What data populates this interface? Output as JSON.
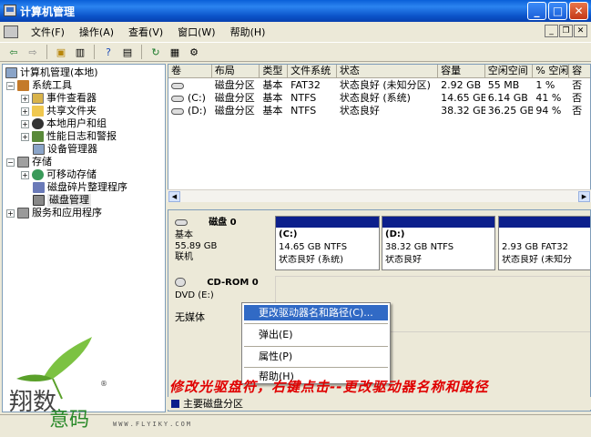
{
  "window": {
    "title": "计算机管理"
  },
  "menu": [
    "文件(F)",
    "操作(A)",
    "查看(V)",
    "窗口(W)",
    "帮助(H)"
  ],
  "tree": {
    "root": "计算机管理(本地)",
    "system_tools": "系统工具",
    "event_viewer": "事件查看器",
    "shared_folders": "共享文件夹",
    "local_users": "本地用户和组",
    "perf_logs": "性能日志和警报",
    "device_manager": "设备管理器",
    "storage": "存储",
    "removable": "可移动存储",
    "defrag": "磁盘碎片整理程序",
    "disk_mgmt": "磁盘管理",
    "services": "服务和应用程序"
  },
  "volume_table": {
    "headers": [
      "卷",
      "布局",
      "类型",
      "文件系统",
      "状态",
      "容量",
      "空闲空间",
      "% 空闲",
      "容"
    ],
    "rows": [
      [
        "",
        "磁盘分区",
        "基本",
        "FAT32",
        "状态良好 (未知分区)",
        "2.92 GB",
        "55 MB",
        "1 %",
        "否"
      ],
      [
        "(C:)",
        "磁盘分区",
        "基本",
        "NTFS",
        "状态良好 (系统)",
        "14.65 GB",
        "6.14 GB",
        "41 %",
        "否"
      ],
      [
        "(D:)",
        "磁盘分区",
        "基本",
        "NTFS",
        "状态良好",
        "38.32 GB",
        "36.25 GB",
        "94 %",
        "否"
      ]
    ]
  },
  "disk0": {
    "name": "磁盘 0",
    "type": "基本",
    "size": "55.89 GB",
    "status": "联机",
    "partitions": [
      {
        "label": "(C:)",
        "size": "14.65 GB NTFS",
        "status": "状态良好 (系统)"
      },
      {
        "label": "(D:)",
        "size": "38.32 GB NTFS",
        "status": "状态良好"
      },
      {
        "label": "",
        "size": "2.93 GB FAT32",
        "status": "状态良好 (未知分"
      }
    ]
  },
  "cdrom0": {
    "name": "CD-ROM 0",
    "type": "DVD (E:)",
    "status": "无媒体"
  },
  "context_menu": [
    "更改驱动器名和路径(C)...",
    "弹出(E)",
    "属性(P)",
    "帮助(H)"
  ],
  "legend": "主要磁盘分区",
  "caption": "修改光驱盘符，右键点击--更改驱动器名称和路径",
  "watermark": {
    "logo_text": "翔数意码",
    "url": "WWW.FLYIKY.COM"
  },
  "colors": {
    "title_bar": "#0a5fd8",
    "partition_bar": "#0c1f8c",
    "highlight": "#316ac5",
    "caption": "#e00000"
  }
}
